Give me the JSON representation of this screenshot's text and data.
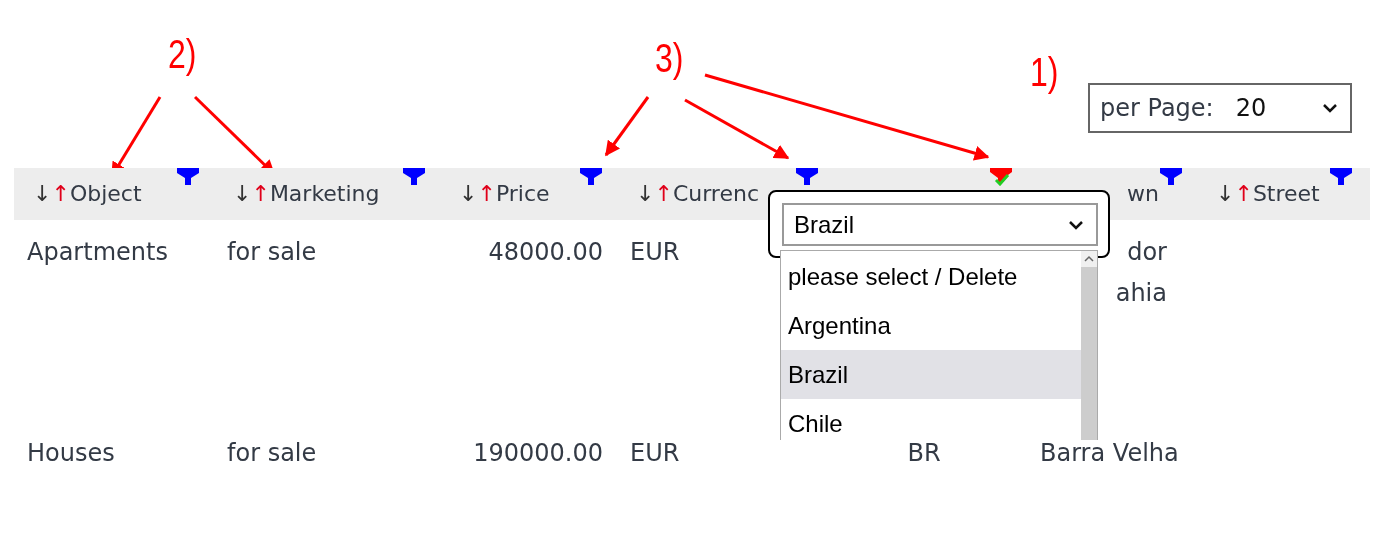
{
  "annotations": [
    {
      "label": "2)"
    },
    {
      "label": "3)"
    },
    {
      "label": "1)"
    }
  ],
  "per_page": {
    "label": "per Page:",
    "value": "20"
  },
  "table": {
    "columns": [
      {
        "sort_down": "↓",
        "sort_up": "↑",
        "label": "Object",
        "filter_active": false,
        "kind": "text"
      },
      {
        "sort_down": "↓",
        "sort_up": "↑",
        "label": "Marketing",
        "filter_active": false,
        "kind": "text"
      },
      {
        "sort_down": "↓",
        "sort_up": "↑",
        "label": "Price",
        "filter_active": false,
        "kind": "number"
      },
      {
        "sort_down": "↓",
        "sort_up": "↑",
        "label": "Currenc",
        "filter_active": false,
        "kind": "text"
      },
      {
        "filter_active": true,
        "kind": "code"
      },
      {
        "label": "wn",
        "clipped": true,
        "filter_active": false,
        "kind": "text"
      },
      {
        "sort_down": "↓",
        "sort_up": "↑",
        "label": "Street",
        "filter_active": false,
        "kind": "text"
      }
    ],
    "rows": [
      {
        "cells": [
          {
            "text": "Apartments"
          },
          {
            "text": "for sale"
          },
          {
            "text": "48000.00"
          },
          {
            "text": "EUR"
          },
          {},
          {
            "text": "dor ahia",
            "clipped": true
          },
          {}
        ]
      },
      {
        "cells": [
          {
            "text": "Houses"
          },
          {
            "text": "for sale"
          },
          {
            "text": "190000.00"
          },
          {
            "text": "EUR"
          },
          {
            "text": "BR"
          },
          {
            "text": "Barra Velha"
          },
          {}
        ]
      }
    ]
  },
  "filter_popup": {
    "value": "Brazil",
    "options": [
      {
        "label": "please select / Delete",
        "selected": false
      },
      {
        "label": "Argentina",
        "selected": false
      },
      {
        "label": "Brazil",
        "selected": true
      },
      {
        "label": "Chile",
        "selected": false
      }
    ]
  }
}
